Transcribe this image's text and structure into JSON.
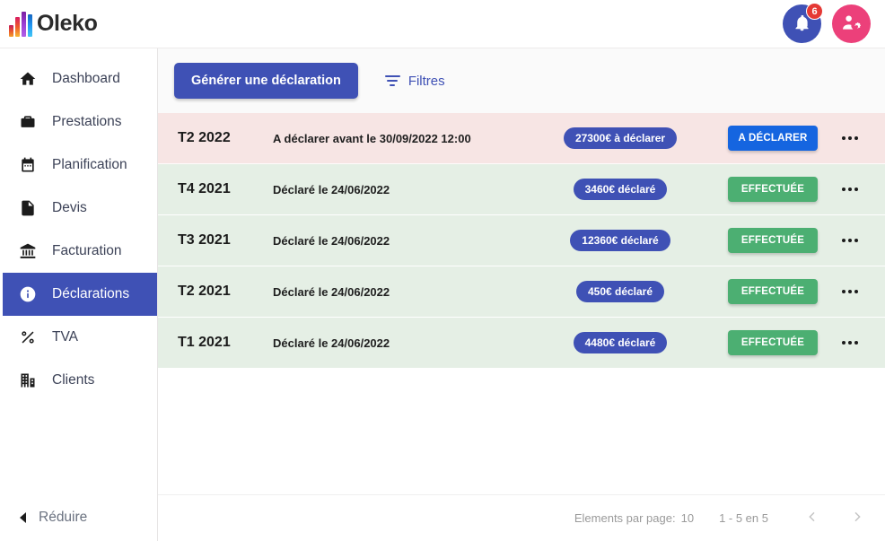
{
  "brand": {
    "name": "Oleko"
  },
  "topbar": {
    "notifications": {
      "icon": "bell-icon",
      "count": "6"
    },
    "account": {
      "icon": "user-settings-icon"
    }
  },
  "sidebar": {
    "items": [
      {
        "label": "Dashboard",
        "icon": "home-icon",
        "active": false
      },
      {
        "label": "Prestations",
        "icon": "briefcase-icon",
        "active": false
      },
      {
        "label": "Planification",
        "icon": "calendar-icon",
        "active": false
      },
      {
        "label": "Devis",
        "icon": "quote-doc-icon",
        "active": false
      },
      {
        "label": "Facturation",
        "icon": "bank-icon",
        "active": false
      },
      {
        "label": "Déclarations",
        "icon": "info-icon",
        "active": true
      },
      {
        "label": "TVA",
        "icon": "percent-icon",
        "active": false
      },
      {
        "label": "Clients",
        "icon": "building-icon",
        "active": false
      }
    ],
    "collapse": {
      "label": "Réduire",
      "icon": "caret-left-icon"
    }
  },
  "toolbar": {
    "generate_label": "Générer une déclaration",
    "filters_label": "Filtres",
    "filters_icon": "filter-icon"
  },
  "table": {
    "rows": [
      {
        "period": "T2 2022",
        "info": "A déclarer avant le 30/09/2022 12:00",
        "amount": "27300€ à déclarer",
        "status": "A DÉCLARER",
        "status_kind": "todo",
        "tone": "pink",
        "menu_icon": "more-options-icon"
      },
      {
        "period": "T4 2021",
        "info": "Déclaré le 24/06/2022",
        "amount": "3460€ déclaré",
        "status": "EFFECTUÉE",
        "status_kind": "done",
        "tone": "green",
        "menu_icon": "more-options-icon"
      },
      {
        "period": "T3 2021",
        "info": "Déclaré le 24/06/2022",
        "amount": "12360€ déclaré",
        "status": "EFFECTUÉE",
        "status_kind": "done",
        "tone": "green",
        "menu_icon": "more-options-icon"
      },
      {
        "period": "T2 2021",
        "info": "Déclaré le 24/06/2022",
        "amount": "450€ déclaré",
        "status": "EFFECTUÉE",
        "status_kind": "done",
        "tone": "green",
        "menu_icon": "more-options-icon"
      },
      {
        "period": "T1 2021",
        "info": "Déclaré le 24/06/2022",
        "amount": "4480€ déclaré",
        "status": "EFFECTUÉE",
        "status_kind": "done",
        "tone": "green",
        "menu_icon": "more-options-icon"
      }
    ]
  },
  "pagination": {
    "per_page_label": "Elements par page:",
    "per_page_value": "10",
    "range_label": "1 - 5 en 5",
    "prev_icon": "chevron-left-icon",
    "next_icon": "chevron-right-icon"
  },
  "colors": {
    "primary": "#3f51b5",
    "status_todo": "#1565e0",
    "status_done": "#4caf72",
    "row_pink": "#f7e5e4",
    "row_green": "#e5efe5",
    "badge_red": "#e53935",
    "account_pink": "#ec407a"
  }
}
